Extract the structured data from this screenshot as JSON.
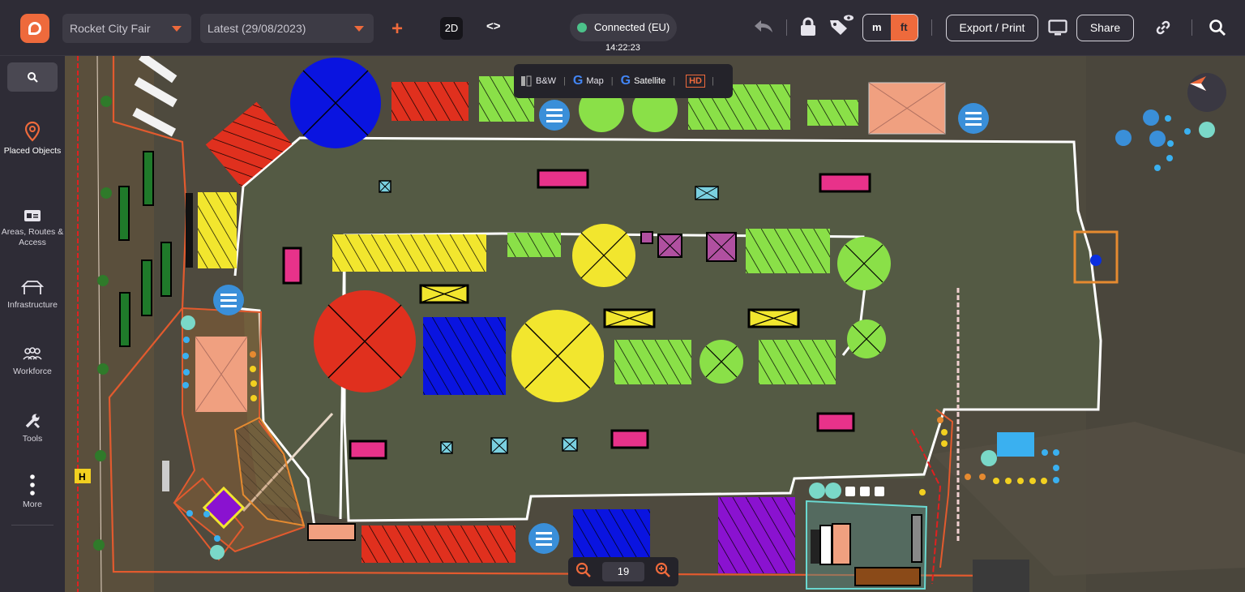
{
  "topbar": {
    "project": "Rocket City Fair",
    "version": "Latest (29/08/2023)",
    "add_label": "+",
    "view_mode": "2D",
    "code_label": "<>",
    "connection": "Connected (EU)",
    "connection_color": "#4cc28a",
    "time": "14:22:23",
    "unit_m": "m",
    "unit_ft": "ft",
    "export_label": "Export / Print",
    "share_label": "Share"
  },
  "sidebar": {
    "items": [
      {
        "label": "Placed Objects",
        "icon": "map-pin-icon"
      },
      {
        "label": "Areas, Routes & Access",
        "icon": "id-card-icon"
      },
      {
        "label": "Infrastructure",
        "icon": "tent-icon"
      },
      {
        "label": "Workforce",
        "icon": "people-icon"
      },
      {
        "label": "Tools",
        "icon": "wrench-icon"
      },
      {
        "label": "More",
        "icon": "more-vertical-icon"
      }
    ]
  },
  "layers": {
    "bw": "B&W",
    "map": "Map",
    "satellite": "Satellite",
    "hd": "HD"
  },
  "zoom": {
    "level": "19"
  },
  "colors": {
    "accent": "#ee6a3c",
    "blue_marker": "#3a8fd9"
  }
}
